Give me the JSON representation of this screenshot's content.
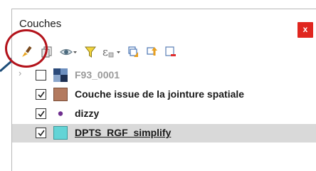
{
  "panel": {
    "title": "Couches",
    "close_label": "x"
  },
  "toolbar": {
    "items": [
      {
        "icon": "paintbrush-style-icon"
      },
      {
        "icon": "add-group-icon"
      },
      {
        "icon": "eye-visibility-icon"
      },
      {
        "icon": "filter-icon"
      },
      {
        "icon": "filter-expression-icon"
      },
      {
        "icon": "expand-all-icon"
      },
      {
        "icon": "collapse-all-icon"
      },
      {
        "icon": "remove-layer-icon"
      }
    ]
  },
  "layers": [
    {
      "name": "F93_0001",
      "checked": false,
      "type": "raster",
      "faded": true,
      "expander": "›"
    },
    {
      "name": "Couche issue de la jointure spatiale",
      "checked": true,
      "type": "polygon",
      "color": "#b37a5f"
    },
    {
      "name": "dizzy",
      "checked": true,
      "type": "point",
      "color": "#6f2f8f"
    },
    {
      "name": "DPTS_RGF_simplify",
      "checked": true,
      "type": "polygon",
      "color": "#63d4d6",
      "selected": true
    }
  ],
  "colors": {
    "highlight": "#b3131b",
    "close_button": "#e0261f",
    "selection": "#d9d9d9"
  }
}
